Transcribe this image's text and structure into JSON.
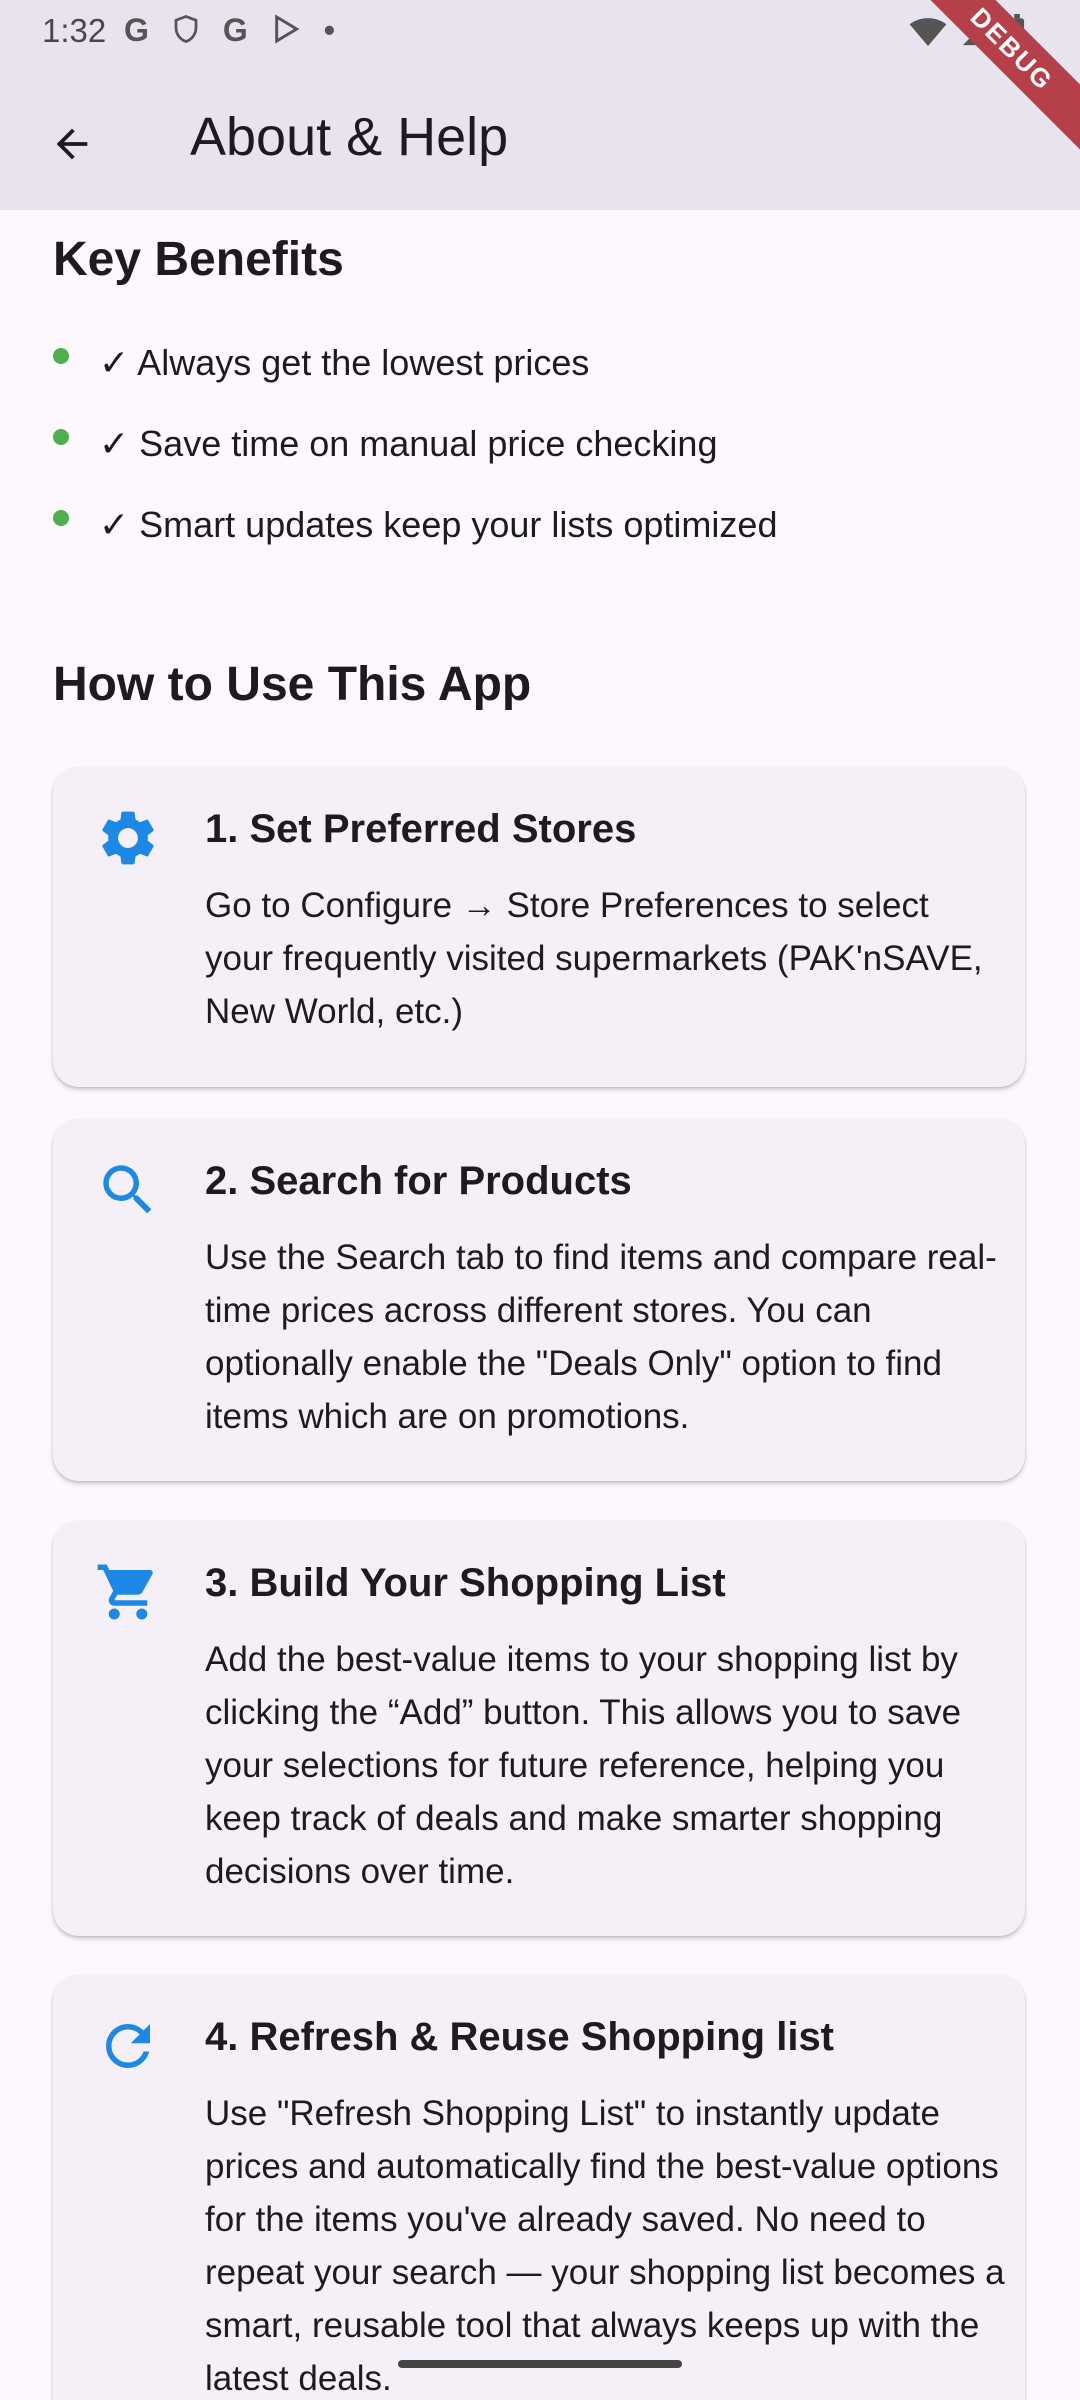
{
  "status_bar": {
    "time": "1:32",
    "icons": [
      "G",
      "shield-icon",
      "G",
      "play-icon",
      "•"
    ]
  },
  "app_bar": {
    "title": "About & Help",
    "debug_label": "DEBUG"
  },
  "key_benefits": {
    "title": "Key Benefits",
    "items": [
      "✓ Always get the lowest prices",
      "✓ Save time on manual price checking",
      "✓ Smart updates keep your lists optimized"
    ]
  },
  "how_to_use": {
    "title": "How to Use This App",
    "cards": [
      {
        "icon": "gear-icon",
        "title": "1. Set Preferred Stores",
        "body": "Go to Configure → Store Preferences to select your frequently visited supermarkets (PAK'nSAVE, New World, etc.)"
      },
      {
        "icon": "search-icon",
        "title": "2. Search for Products",
        "body": "Use the Search tab to find items and compare real-time prices across different stores. You can optionally enable the \"Deals Only\" option to find items which are on promotions."
      },
      {
        "icon": "cart-icon",
        "title": "3. Build Your Shopping List",
        "body": "Add the best-value items to your shopping list by clicking the “Add” button. This allows you to save your selections for future reference, helping you keep track of deals and make smarter shopping decisions over time."
      },
      {
        "icon": "refresh-icon",
        "title": "4. Refresh & Reuse Shopping list",
        "body": "Use \"Refresh Shopping List\" to instantly update prices and automatically find the best-value options for the items you've already saved. No need to repeat your search — your shopping list becomes a smart, reusable tool that always keeps up with the latest deals."
      }
    ]
  },
  "colors": {
    "accent": "#1e88e5",
    "bullet": "#4caf50",
    "app_bar": "#e8e3ee",
    "card": "#f5eff7"
  }
}
